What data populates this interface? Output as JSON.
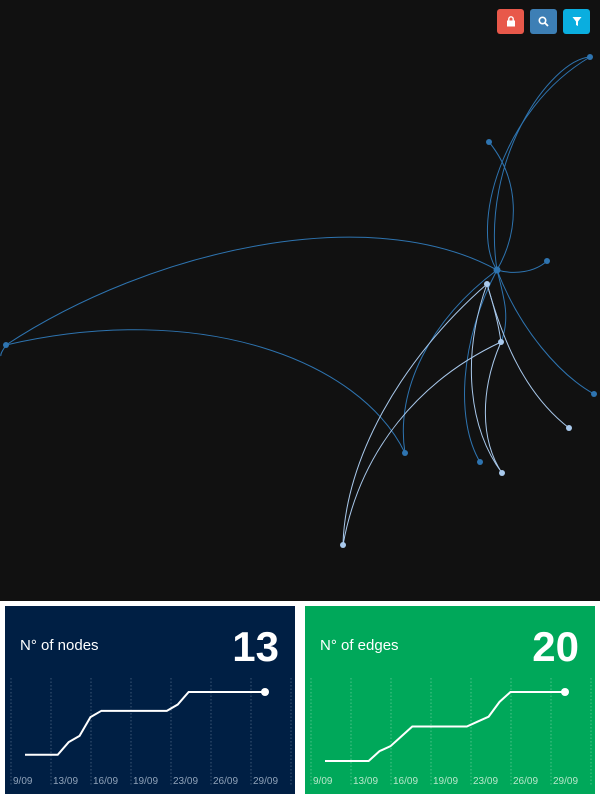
{
  "graph": {
    "background": "#111111",
    "node_color": "#2e74b0",
    "highlight_color": "#a9c9ec",
    "toolbar": [
      {
        "name": "lock-button",
        "icon": "lock-icon",
        "color": "#e8584a"
      },
      {
        "name": "search-button",
        "icon": "search-icon",
        "color": "#3d7fb5"
      },
      {
        "name": "filter-button",
        "icon": "filter-icon",
        "color": "#0aaedf"
      }
    ]
  },
  "stats": [
    {
      "key": "nodes",
      "label": "N° of nodes",
      "value": "13",
      "background": "#001f44",
      "tick_color": "#8fa2b8",
      "chart_data": {
        "type": "line",
        "categories": [
          "9/09",
          "13/09",
          "16/09",
          "19/09",
          "23/09",
          "26/09",
          "29/09"
        ],
        "x": [
          0,
          1,
          2,
          3,
          4,
          5,
          6,
          7,
          8,
          9,
          10,
          11,
          12,
          13,
          14,
          15,
          16,
          17,
          18,
          19,
          20,
          21,
          22
        ],
        "values": [
          1,
          1,
          1,
          1,
          3,
          4,
          7,
          8,
          8,
          8,
          8,
          8,
          8,
          8,
          9,
          11,
          11,
          11,
          11,
          11,
          11,
          11,
          11
        ]
      }
    },
    {
      "key": "edges",
      "label": "N° of edges",
      "value": "20",
      "background": "#00a85a",
      "tick_color": "#b7e6c9",
      "chart_data": {
        "type": "line",
        "categories": [
          "9/09",
          "13/09",
          "16/09",
          "19/09",
          "23/09",
          "26/09",
          "29/09"
        ],
        "x": [
          0,
          1,
          2,
          3,
          4,
          5,
          6,
          7,
          8,
          9,
          10,
          11,
          12,
          13,
          14,
          15,
          16,
          17,
          18,
          19,
          20,
          21,
          22
        ],
        "values": [
          0,
          0,
          0,
          0,
          0,
          2,
          3,
          5,
          7,
          7,
          7,
          7,
          7,
          7,
          8,
          9,
          12,
          14,
          14,
          14,
          14,
          14,
          14
        ]
      }
    }
  ]
}
